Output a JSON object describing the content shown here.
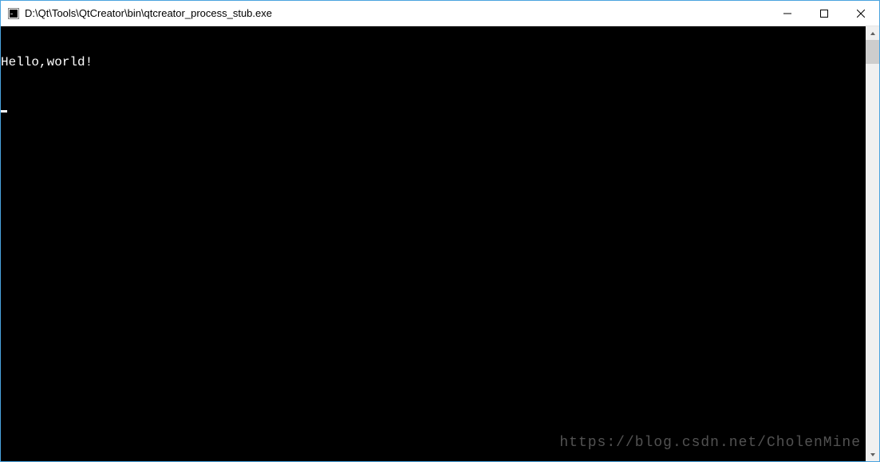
{
  "window": {
    "title": "D:\\Qt\\Tools\\QtCreator\\bin\\qtcreator_process_stub.exe"
  },
  "console": {
    "lines": [
      "Hello,world!"
    ]
  },
  "watermark": "https://blog.csdn.net/CholenMine"
}
